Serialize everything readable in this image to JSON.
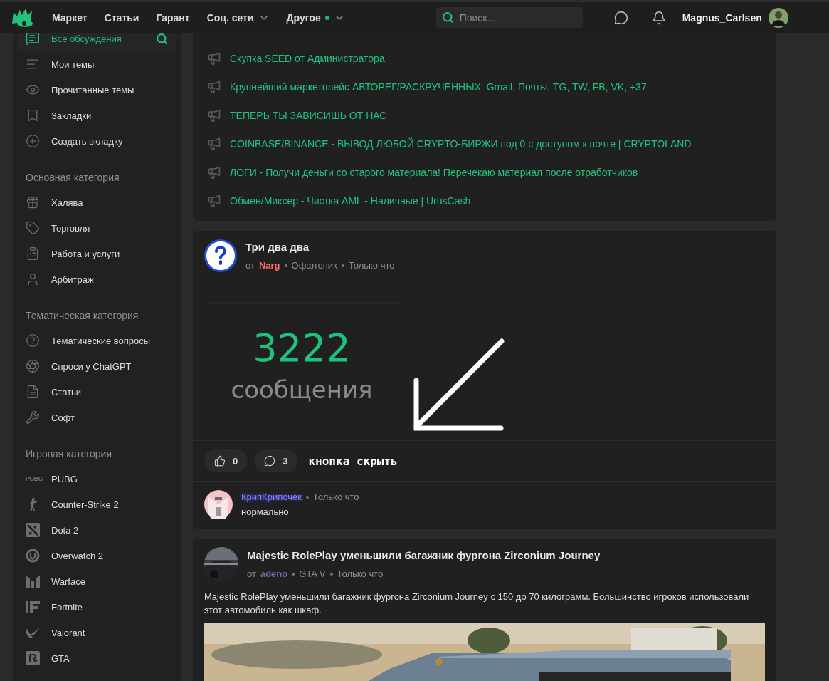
{
  "header": {
    "nav": [
      {
        "label": "Маркет",
        "dropdown": false,
        "dot": false
      },
      {
        "label": "Статьи",
        "dropdown": false,
        "dot": false
      },
      {
        "label": "Гарант",
        "dropdown": false,
        "dot": false
      },
      {
        "label": "Соц. сети",
        "dropdown": true,
        "dot": false
      },
      {
        "label": "Другое",
        "dropdown": true,
        "dot": true
      }
    ],
    "search": {
      "placeholder": "Поиск..."
    },
    "user": {
      "name": "Magnus_Carlsen"
    }
  },
  "sidebar": {
    "sections": [
      {
        "items": [
          {
            "label": "Все обсуждения",
            "selected": true
          },
          {
            "label": "Мои темы",
            "selected": false
          },
          {
            "label": "Прочитанные темы",
            "selected": false
          },
          {
            "label": "Закладки",
            "selected": false
          },
          {
            "label": "Создать вкладку",
            "selected": false
          }
        ]
      },
      {
        "heading": "Основная категория",
        "items": [
          {
            "label": "Халява",
            "selected": false
          },
          {
            "label": "Торговля",
            "selected": false
          },
          {
            "label": "Работа и услуги",
            "selected": false
          },
          {
            "label": "Арбитраж",
            "selected": false
          }
        ]
      },
      {
        "heading": "Тематическая категория",
        "items": [
          {
            "label": "Тематические вопросы",
            "selected": false
          },
          {
            "label": "Спроси у ChatGPT",
            "selected": false
          },
          {
            "label": "Статьи",
            "selected": false
          },
          {
            "label": "Софт",
            "selected": false
          }
        ]
      },
      {
        "heading": "Игровая категория",
        "items": [
          {
            "label": "PUBG",
            "selected": false,
            "logo_text": "PUBG"
          },
          {
            "label": "Counter-Strike 2",
            "selected": false
          },
          {
            "label": "Dota 2",
            "selected": false
          },
          {
            "label": "Overwatch 2",
            "selected": false
          },
          {
            "label": "Warface",
            "selected": false
          },
          {
            "label": "Fortnite",
            "selected": false
          },
          {
            "label": "Valorant",
            "selected": false
          },
          {
            "label": "GTA",
            "selected": false
          }
        ]
      }
    ]
  },
  "announcements": [
    "Скупка SEED от Администратора",
    "Крупнейший маркетплейс АВТОРЕГ/РАСКРУЧЕННЫХ: Gmail, Почты, TG, TW, FB, VK, +37",
    "ТЕПЕРЬ ТЫ ЗАВИСИШЬ ОТ НАС",
    "COINBASE/BINANCE - ВЫВОД ЛЮБОЙ CRYPTO-БИРЖИ под 0 с доступом к почте | CRYPTOLAND",
    "ЛОГИ - Получи деньги со старого материала! Перечекаю материал после отработчиков",
    "Обмен/Миксер - Чистка AML - Наличные | UrusCash"
  ],
  "posts": [
    {
      "kind": "stat",
      "title": "Три два два",
      "by": "от",
      "author": {
        "name": "Narg",
        "color": "#ff6b6b"
      },
      "category": "Оффтопик",
      "time": "Только что",
      "number": "3222",
      "caption": "сообщения",
      "likes": "0",
      "comments": "3",
      "annotation": "кнопка скрыть",
      "comment": {
        "name": "КрипКрипочек",
        "time": "Только что",
        "text": "нормально"
      }
    },
    {
      "kind": "picture",
      "title": "Majestic RolePlay уменьшили багажник фургона Zirconium Journey",
      "by": "от",
      "author": {
        "name": "adeno",
        "color": "#6f6fae"
      },
      "category": "GTA V",
      "time": "Только что",
      "text": "Majestic RolePlay уменьшили багажник фургона Zirconium Journey с 150 до 70 килограмм. Большинство игроков использовали этот автомобиль как шкаф."
    }
  ]
}
